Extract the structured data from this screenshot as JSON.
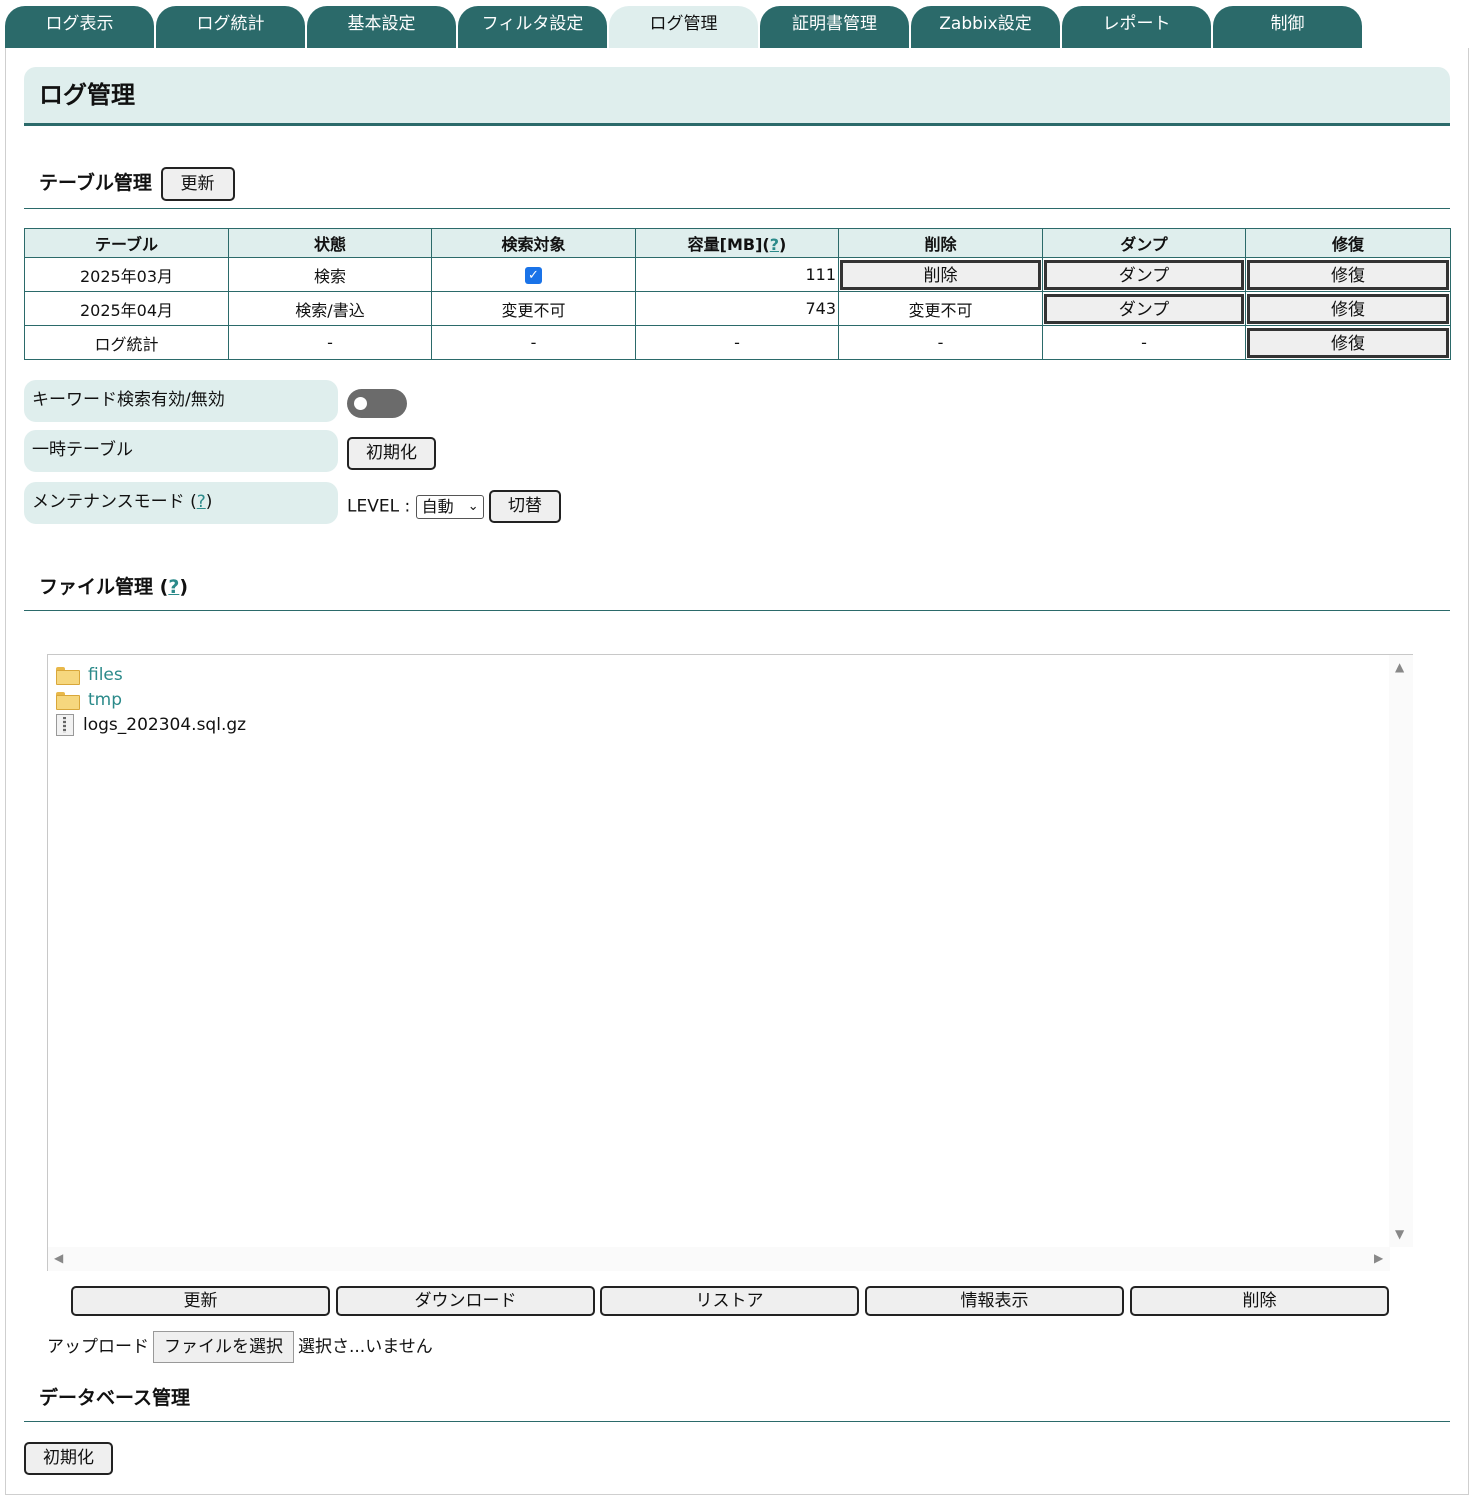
{
  "tabs": [
    "ログ表示",
    "ログ統計",
    "基本設定",
    "フィルタ設定",
    "ログ管理",
    "証明書管理",
    "Zabbix設定",
    "レポート",
    "制御"
  ],
  "active_tab": "ログ管理",
  "page_title": "ログ管理",
  "table_section": {
    "title": "テーブル管理",
    "refresh_label": "更新",
    "headers": {
      "table": "テーブル",
      "state": "状態",
      "search_target": "検索対象",
      "capacity": "容量[MB](",
      "capacity_help": "?",
      "capacity_close": ")",
      "delete": "削除",
      "dump": "ダンプ",
      "repair": "修復"
    },
    "rows": [
      {
        "name": "2025年03月",
        "state": "検索",
        "search_target_checked": true,
        "capacity": "111",
        "delete": "削除",
        "dump": "ダンプ",
        "repair": "修復"
      },
      {
        "name": "2025年04月",
        "state": "検索/書込",
        "search_target": "変更不可",
        "capacity": "743",
        "delete": "変更不可",
        "dump": "ダンプ",
        "repair": "修復"
      },
      {
        "name": "ログ統計",
        "state": "-",
        "search_target": "-",
        "capacity": "-",
        "delete": "-",
        "dump": "-",
        "repair": "修復"
      }
    ]
  },
  "settings": {
    "keyword_search_label": "キーワード検索有効/無効",
    "keyword_search_enabled": false,
    "temp_table_label": "一時テーブル",
    "temp_table_button": "初期化",
    "maintenance_label": "メンテナンスモード (",
    "maintenance_help": "?",
    "maintenance_close": ")",
    "level_label": "LEVEL :",
    "level_value": "自動",
    "switch_button": "切替"
  },
  "file_section": {
    "title": "ファイル管理 (",
    "help": "?",
    "title_close": ")",
    "items": [
      {
        "name": "files",
        "type": "folder"
      },
      {
        "name": "tmp",
        "type": "folder"
      },
      {
        "name": "logs_202304.sql.gz",
        "type": "file"
      }
    ],
    "buttons": {
      "refresh": "更新",
      "download": "ダウンロード",
      "restore": "リストア",
      "info": "情報表示",
      "delete": "削除"
    },
    "upload_label": "アップロード",
    "choose_file": "ファイルを選択",
    "no_file": "選択さ...いません"
  },
  "db_section": {
    "title": "データベース管理",
    "init_button": "初期化"
  },
  "colors": {
    "tab_bg": "#2b6a6a",
    "accent_light": "#dfeeed",
    "link": "#2b8a8a",
    "checkbox": "#1a73e8"
  }
}
